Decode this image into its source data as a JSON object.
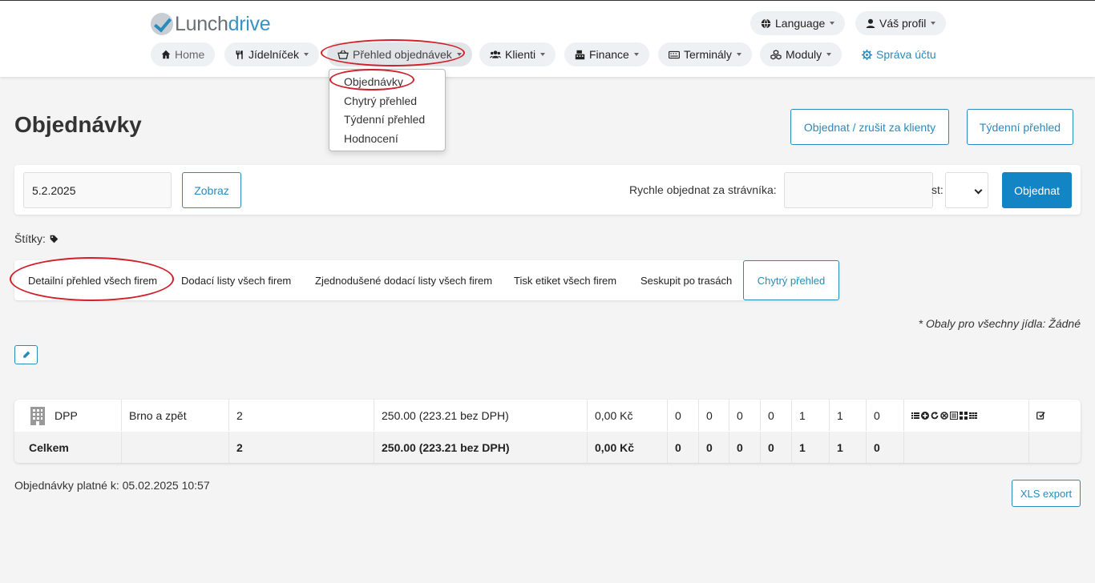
{
  "header": {
    "logo": {
      "part1": "Lunch",
      "part2": "drive"
    },
    "language_label": "Language",
    "profile_label": "Váš profil",
    "nav": {
      "home": "Home",
      "menu": "Jídelníček",
      "orders": "Přehled objednávek",
      "clients": "Klienti",
      "finance": "Finance",
      "terminals": "Terminály",
      "modules": "Moduly",
      "account": "Správa účtu"
    }
  },
  "dropdown": {
    "items": [
      "Objednávky",
      "Chytrý přehled",
      "Týdenní přehled",
      "Hodnocení"
    ]
  },
  "page": {
    "title": "Objednávky",
    "order_cancel_btn": "Objednat / zrušit za klienty",
    "weekly_btn": "Týdenní přehled"
  },
  "filter": {
    "date_value": "5.2.2025",
    "show_btn": "Zobraz",
    "quick_order_label": "Rychle objednat za strávníka:",
    "quick_order_value": "",
    "count_label": "st:",
    "order_btn": "Objednat"
  },
  "tags_label": "Štítky:",
  "tabs": [
    "Detailní přehled všech firem",
    "Dodací listy všech firem",
    "Zjednodušené dodací listy všech firem",
    "Tisk etiket všech firem",
    "Seskupit po trasách",
    "Chytrý přehled"
  ],
  "packaging_note": "* Obaly pro všechny jídla: Žádné",
  "table": {
    "rows": [
      {
        "company": "DPP",
        "route": "Brno a zpět",
        "count": "2",
        "price": "250.00 (223.21 bez DPH)",
        "amount": "0,00 Kč",
        "n": [
          "0",
          "0",
          "0",
          "0",
          "1",
          "1",
          "0"
        ]
      }
    ],
    "total": {
      "label": "Celkem",
      "count": "2",
      "price": "250.00 (223.21 bez DPH)",
      "amount": "0,00 Kč",
      "n": [
        "0",
        "0",
        "0",
        "0",
        "1",
        "1",
        "0"
      ]
    }
  },
  "valid_text": "Objednávky platné k: 05.02.2025 10:57",
  "xls_btn": "XLS export",
  "colors": {
    "accent": "#2a8ab9",
    "primary_btn": "#1385c4",
    "highlight_ring": "#d0202a"
  }
}
